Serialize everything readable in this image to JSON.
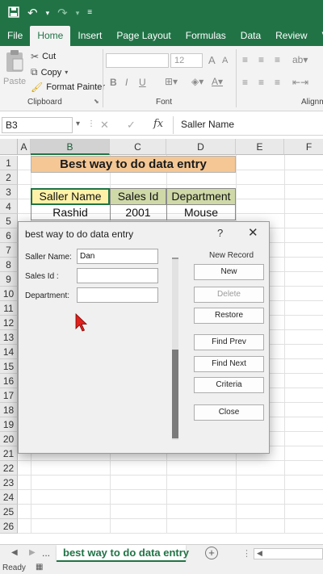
{
  "quick_access": {
    "icons": [
      "save-icon",
      "undo-icon",
      "undo-dropdown-icon",
      "redo-icon",
      "redo-dropdown-icon",
      "customize-icon"
    ]
  },
  "ribbon_tabs": [
    "File",
    "Home",
    "Insert",
    "Page Layout",
    "Formulas",
    "Data",
    "Review",
    "View"
  ],
  "active_tab": "Home",
  "clipboard": {
    "paste_label": "Paste",
    "cut_label": "Cut",
    "copy_label": "Copy",
    "format_painter_label": "Format Painter",
    "group_label": "Clipboard"
  },
  "font_group": {
    "size_value": "12",
    "grow_label": "A",
    "shrink_label": "A",
    "bold": "B",
    "italic": "I",
    "underline": "U",
    "group_label": "Font"
  },
  "alignment_group": {
    "group_label": "Alignm"
  },
  "formula_bar": {
    "name_box": "B3",
    "fx": "fx",
    "content": "Saller Name"
  },
  "columns": [
    "A",
    "B",
    "C",
    "D",
    "E",
    "F"
  ],
  "rows": [
    "1",
    "2",
    "3",
    "4",
    "5",
    "6",
    "7",
    "8",
    "9",
    "10",
    "11",
    "12",
    "13",
    "14",
    "15",
    "16",
    "17",
    "18",
    "19",
    "20",
    "21",
    "22",
    "23",
    "24",
    "25",
    "26"
  ],
  "sheet": {
    "title": "Best way to do data entry",
    "headers": [
      "Saller Name",
      "Sales Id",
      "Department"
    ],
    "first_row": [
      "Rashid",
      "2001",
      "Mouse"
    ]
  },
  "dialog": {
    "title": "best way to do data entry",
    "help": "?",
    "close": "✕",
    "record_label": "New Record",
    "fields": [
      {
        "label": "Saller Name:",
        "value": "Dan"
      },
      {
        "label": "Sales Id :",
        "value": ""
      },
      {
        "label": "Department:",
        "value": ""
      }
    ],
    "buttons": [
      "New",
      "Delete",
      "Restore",
      "Find Prev",
      "Find Next",
      "Criteria",
      "Close"
    ]
  },
  "sheet_tabs": {
    "more": "...",
    "active": "best way to do data entry",
    "add": "+"
  },
  "status": {
    "ready": "Ready"
  },
  "colors": {
    "excel_green": "#217346",
    "title_fill": "#f4c795",
    "header_fill": "#fff2a8",
    "header_fill_alt": "#cfd9a8"
  }
}
